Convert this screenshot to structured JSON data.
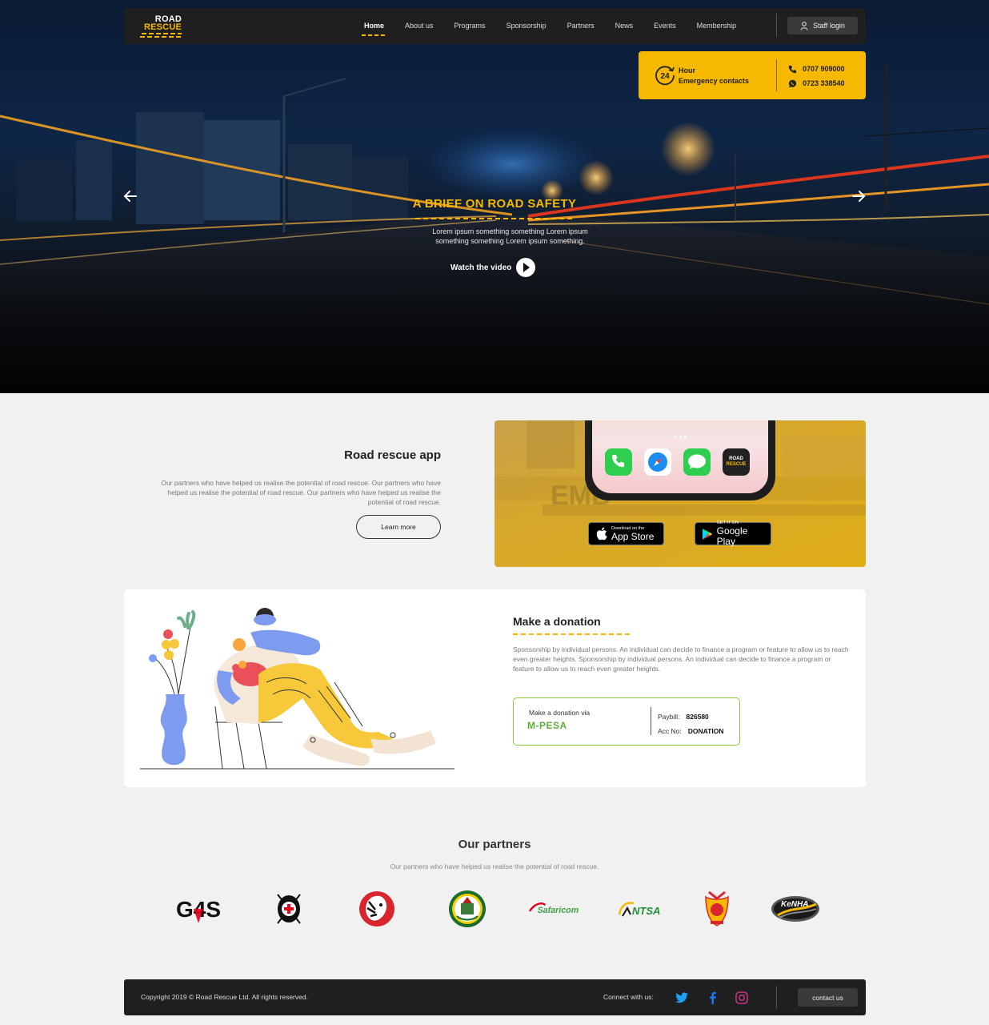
{
  "brand": {
    "line1": "ROAD",
    "line2": "RESCUE",
    "accent": "#f6b800"
  },
  "nav": {
    "items": [
      "Home",
      "About us",
      "Programs",
      "Sponsorship",
      "Partners",
      "News",
      "Events",
      "Membership"
    ],
    "active": "Home",
    "staff_login": "Staff login"
  },
  "emergency": {
    "badge": "24",
    "line1": "Hour",
    "line2": "Emergency contacts",
    "phone1": "0707 909000",
    "phone2": "0723 338540"
  },
  "hero": {
    "title": "A BRIEF ON ROAD SAFETY",
    "subtitle": "Lorem ipsum something something Lorem ipsum something something Lorem ipsum something.",
    "cta": "Watch the video"
  },
  "app": {
    "title": "Road rescue app",
    "description": "Our partners who have helped us realise the potential of road rescue.  Our partners who have helped us realise the potential of road rescue. Our partners who have helped us realise the potential of road rescue.",
    "learn_more": "Learn more",
    "app_icon_label_1": "ROAD",
    "app_icon_label_2": "RESCUE",
    "appstore_small": "Download on the",
    "appstore_big": "App Store",
    "googleplay_small": "GET IT ON",
    "googleplay_big": "Google Play"
  },
  "donation": {
    "title": "Make a donation",
    "description": "Sponsorship by individual persons. An individual can decide to finance a program or feature to allow us to reach even greater heights.  Sponsorship by individual persons. An individual can decide to finance a program or feature to allow us to reach even greater heights.",
    "via_label": "Make a donation via",
    "mpesa": "M-PESA",
    "paybill_label": "Paybill:",
    "paybill_value": "826580",
    "acc_label": "Acc No:",
    "acc_value": "DONATION"
  },
  "partners": {
    "title": "Our partners",
    "description": "Our partners who have helped us realise the potential of road rescue.",
    "logos": [
      "G4S",
      "red-cross",
      "lion",
      "county-seal",
      "Safaricom",
      "NTSA",
      "fire-service",
      "KeNHA"
    ],
    "safaricom_text": "Safaricom",
    "ntsa_text": "NTSA",
    "kenha_text": "KeNHA",
    "g4s_text": "G4S"
  },
  "footer": {
    "copyright": "Copyright 2019 © Road Rescue Ltd.  All rights reserved.",
    "connect": "Connect with us:",
    "contact": "contact us",
    "social": [
      "twitter-icon",
      "facebook-icon",
      "instagram-icon"
    ]
  }
}
